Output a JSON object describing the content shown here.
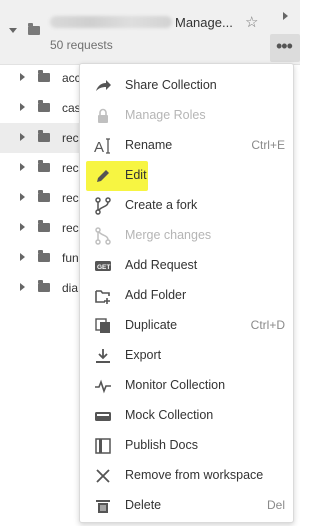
{
  "header": {
    "title_suffix": "Manage...",
    "subtitle": "50 requests"
  },
  "folders": [
    {
      "label": "acc"
    },
    {
      "label": "cas"
    },
    {
      "label": "rec"
    },
    {
      "label": "rec"
    },
    {
      "label": "rec"
    },
    {
      "label": "rec"
    },
    {
      "label": "fun"
    },
    {
      "label": "dia"
    }
  ],
  "menu": {
    "items": [
      {
        "label": "Share Collection",
        "shortcut": "",
        "icon": "share-icon",
        "enabled": true
      },
      {
        "label": "Manage Roles",
        "shortcut": "",
        "icon": "lock-icon",
        "enabled": false
      },
      {
        "label": "Rename",
        "shortcut": "Ctrl+E",
        "icon": "rename-icon",
        "enabled": true
      },
      {
        "label": "Edit",
        "shortcut": "",
        "icon": "pencil-icon",
        "enabled": true,
        "highlight": "#f7f542"
      },
      {
        "label": "Create a fork",
        "shortcut": "",
        "icon": "fork-icon",
        "enabled": true
      },
      {
        "label": "Merge changes",
        "shortcut": "",
        "icon": "merge-icon",
        "enabled": false
      },
      {
        "label": "Add Request",
        "shortcut": "",
        "icon": "get-request-icon",
        "enabled": true
      },
      {
        "label": "Add Folder",
        "shortcut": "",
        "icon": "add-folder-icon",
        "enabled": true
      },
      {
        "label": "Duplicate",
        "shortcut": "Ctrl+D",
        "icon": "duplicate-icon",
        "enabled": true
      },
      {
        "label": "Export",
        "shortcut": "",
        "icon": "export-icon",
        "enabled": true
      },
      {
        "label": "Monitor Collection",
        "shortcut": "",
        "icon": "monitor-icon",
        "enabled": true
      },
      {
        "label": "Mock Collection",
        "shortcut": "",
        "icon": "mock-server-icon",
        "enabled": true
      },
      {
        "label": "Publish Docs",
        "shortcut": "",
        "icon": "docs-icon",
        "enabled": true
      },
      {
        "label": "Remove from workspace",
        "shortcut": "",
        "icon": "close-icon",
        "enabled": true
      },
      {
        "label": "Delete",
        "shortcut": "Del",
        "icon": "trash-icon",
        "enabled": true
      }
    ]
  },
  "colors": {
    "highlight": "#f7f542",
    "disabled_text": "#b5b5b5",
    "header_bg": "#f0f0f0"
  }
}
